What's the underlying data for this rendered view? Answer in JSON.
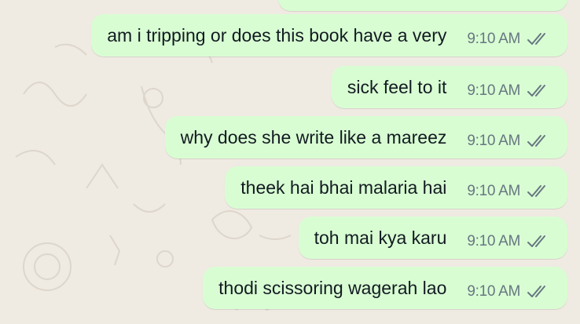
{
  "colors": {
    "background": "#efeae2",
    "outgoing_bubble": "#d9fdd3",
    "message_text": "#111b21",
    "timestamp_text": "#667781",
    "read_ticks": "#667781"
  },
  "messages": [
    {
      "text": "am i tripping or does this book have a very",
      "time": "9:10 AM",
      "status_icon": "double-check-icon"
    },
    {
      "text": "sick feel to it",
      "time": "9:10 AM",
      "status_icon": "double-check-icon"
    },
    {
      "text": "why does she write like a mareez",
      "time": "9:10 AM",
      "status_icon": "double-check-icon"
    },
    {
      "text": "theek hai bhai malaria hai",
      "time": "9:10 AM",
      "status_icon": "double-check-icon"
    },
    {
      "text": "toh mai kya karu",
      "time": "9:10 AM",
      "status_icon": "double-check-icon"
    },
    {
      "text": "thodi scissoring wagerah lao",
      "time": "9:10 AM",
      "status_icon": "double-check-icon"
    }
  ]
}
